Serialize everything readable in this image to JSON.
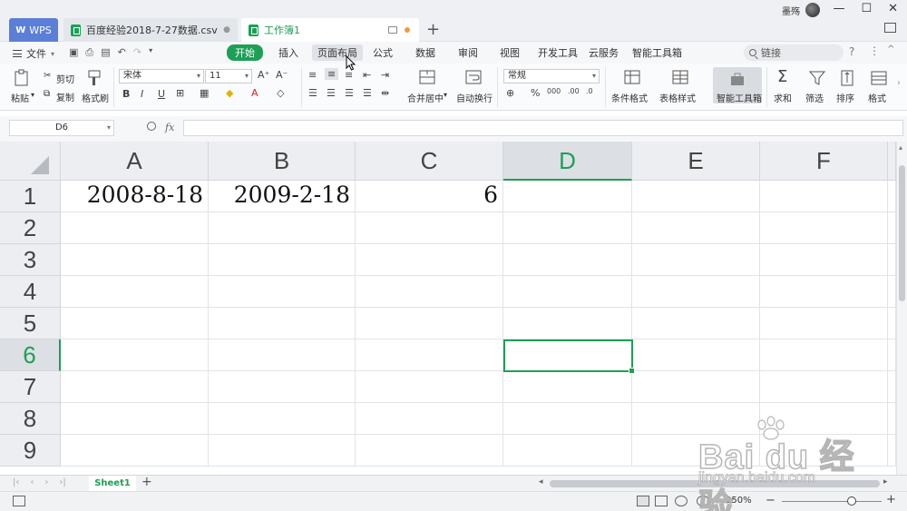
{
  "titlebar": {
    "tabs": [
      {
        "label": "WPS"
      },
      {
        "label": "百度经验2018-7-27数据.csv"
      },
      {
        "label": "工作簿1"
      }
    ],
    "user_name": "墨殇"
  },
  "menu": {
    "file_label": "文件",
    "items": [
      "开始",
      "插入",
      "页面布局",
      "公式",
      "数据",
      "审阅",
      "视图",
      "开发工具",
      "云服务",
      "智能工具箱"
    ],
    "active": "开始",
    "search_placeholder": "链接"
  },
  "ribbon": {
    "paste": "粘贴",
    "cut": "剪切",
    "copy": "复制",
    "format_painter": "格式刷",
    "font_name": "宋体",
    "font_size": "11",
    "merge_center": "合并居中",
    "wrap_text": "自动换行",
    "number_format": "常规",
    "conditional_format": "条件格式",
    "table_style": "表格样式",
    "smart_toolbox": "智能工具箱",
    "sum": "求和",
    "filter": "筛选",
    "sort": "排序",
    "format": "格式"
  },
  "formula_bar": {
    "name_box": "D6",
    "fx": "fx",
    "value": ""
  },
  "sheet": {
    "columns": [
      "A",
      "B",
      "C",
      "D",
      "E",
      "F"
    ],
    "rows": [
      "1",
      "2",
      "3",
      "4",
      "5",
      "6",
      "7",
      "8",
      "9"
    ],
    "selected_column": "D",
    "selected_row": "6",
    "cells": {
      "A1": "2008-8-18",
      "B1": "2009-2-18",
      "C1": "6"
    },
    "tab_name": "Sheet1"
  },
  "statusbar": {
    "zoom": "250%"
  },
  "watermark": {
    "brand": "Bai du 经验",
    "url": "jingyan.baidu.com"
  },
  "colors": {
    "accent": "#1e9f56",
    "wps_blue": "#5b7fd6"
  }
}
